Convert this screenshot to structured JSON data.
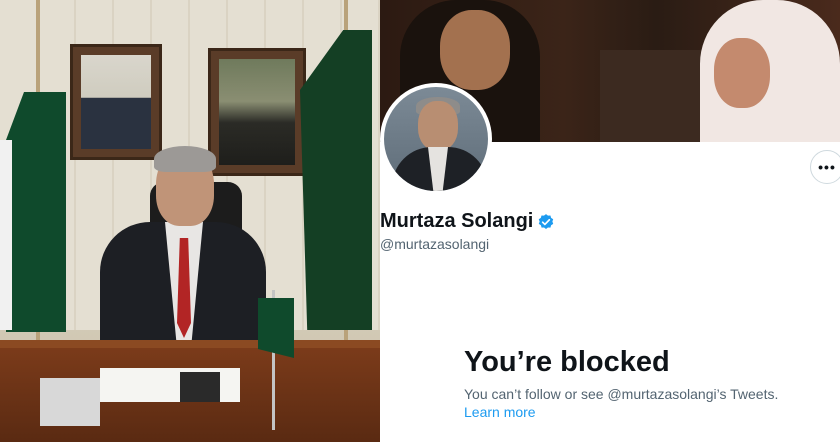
{
  "profile": {
    "display_name": "Murtaza Solangi",
    "handle": "@murtazasolangi",
    "more_label": "•••"
  },
  "blocked": {
    "title": "You’re blocked",
    "description": "You can’t follow or see @murtazasolangi’s Tweets.",
    "learn_more": "Learn more"
  },
  "icons": {
    "verified": "verified-badge-icon",
    "more": "more-options-icon"
  },
  "colors": {
    "accent": "#1d9bf0",
    "text_primary": "#0f1419",
    "text_secondary": "#536471",
    "flag_green": "#0f4a2c"
  }
}
